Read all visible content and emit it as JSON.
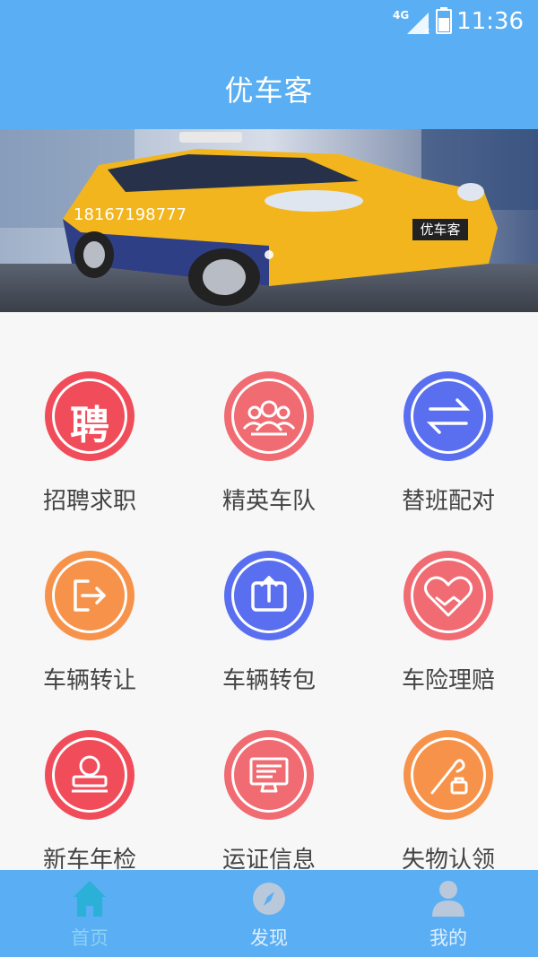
{
  "status_bar": {
    "network": "4G",
    "time": "11:36"
  },
  "app": {
    "title": "优车客"
  },
  "banner": {
    "phone": "18167198777",
    "plate": "优车客"
  },
  "grid": [
    {
      "label": "招聘求职",
      "icon": "hiring-icon",
      "color": "#f04c5a"
    },
    {
      "label": "精英车队",
      "icon": "team-icon",
      "color": "#f06b72"
    },
    {
      "label": "替班配对",
      "icon": "swap-icon",
      "color": "#5a6ff0"
    },
    {
      "label": "车辆转让",
      "icon": "transfer-icon",
      "color": "#f7924a"
    },
    {
      "label": "车辆转包",
      "icon": "share-icon",
      "color": "#5a6ff0"
    },
    {
      "label": "车险理赔",
      "icon": "handshake-heart-icon",
      "color": "#f06b72"
    },
    {
      "label": "新车年检",
      "icon": "stamp-icon",
      "color": "#f04c5a"
    },
    {
      "label": "运证信息",
      "icon": "monitor-icon",
      "color": "#f06b72"
    },
    {
      "label": "失物认领",
      "icon": "lost-item-icon",
      "color": "#f7924a"
    }
  ],
  "hiring_char": "聘",
  "tabs": [
    {
      "label": "首页",
      "icon": "home-icon"
    },
    {
      "label": "发现",
      "icon": "compass-icon"
    },
    {
      "label": "我的",
      "icon": "person-icon"
    }
  ],
  "colors": {
    "primary": "#5aaef3",
    "tab_active": "#8cd2f5"
  }
}
